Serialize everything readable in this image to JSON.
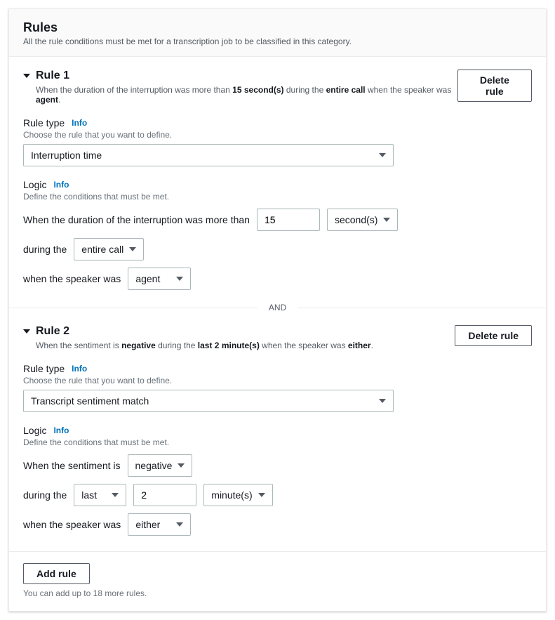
{
  "header": {
    "title": "Rules",
    "subtitle": "All the rule conditions must be met for a transcription job to be classified in this category."
  },
  "labels": {
    "rule_type": "Rule type",
    "info": "Info",
    "rule_type_help": "Choose the rule that you want to define.",
    "logic": "Logic",
    "logic_help": "Define the conditions that must be met.",
    "delete_rule": "Delete rule",
    "and": "AND",
    "add_rule": "Add rule",
    "during_the": "during the",
    "when_speaker": "when the speaker was"
  },
  "rule1": {
    "title": "Rule 1",
    "summary_pre": "When the duration of the interruption was more than ",
    "summary_val": "15 second(s)",
    "summary_mid": " during the ",
    "summary_call": "entire call",
    "summary_speaker_pre": " when the speaker was ",
    "summary_speaker": "agent",
    "summary_end": ".",
    "rule_type_value": "Interruption time",
    "logic_leading": "When the duration of the interruption was more than",
    "duration_value": "15",
    "duration_unit": "second(s)",
    "during_value": "entire call",
    "speaker_value": "agent"
  },
  "rule2": {
    "title": "Rule 2",
    "summary_pre": "When the sentiment is ",
    "summary_neg": "negative",
    "summary_mid": " during the ",
    "summary_period": "last 2 minute(s)",
    "summary_speaker_pre": " when the speaker was ",
    "summary_speaker": "either",
    "summary_end": ".",
    "rule_type_value": "Transcript sentiment match",
    "logic_leading": "When the sentiment is",
    "sentiment_value": "negative",
    "during_value": "last",
    "during_number": "2",
    "during_unit": "minute(s)",
    "speaker_value": "either"
  },
  "footer": {
    "note": "You can add up to 18 more rules."
  }
}
